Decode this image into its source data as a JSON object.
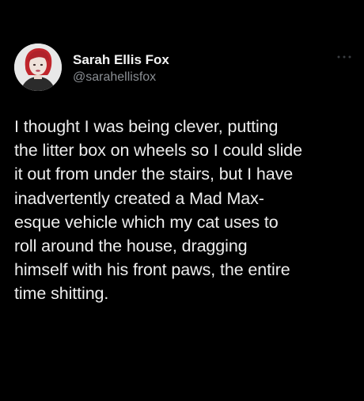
{
  "tweet": {
    "author": {
      "display_name": "Sarah Ellis Fox",
      "handle": "@sarahellisfox",
      "avatar_icon": "profile-photo"
    },
    "more_icon": "more-horizontal-icon",
    "text": "I thought I was being clever, putting\nthe litter box on wheels so I could slide\nit out from under the stairs, but I have\ninadvertently created a Mad Max-\nesque vehicle which my cat uses to\nroll around the house, dragging\nhimself with his front paws, the entire\ntime shitting."
  },
  "colors": {
    "background": "#000000",
    "name": "#f4f4f4",
    "handle": "#8b8f94",
    "body_text": "#ededed",
    "avatar_hair": "#c0262c"
  }
}
